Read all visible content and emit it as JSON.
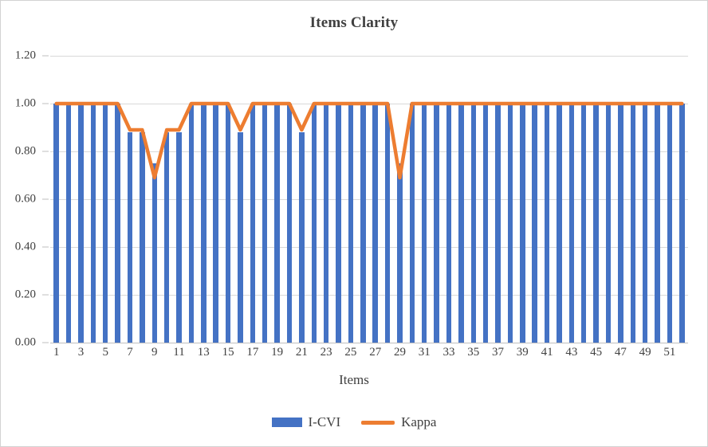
{
  "chart_data": {
    "type": "bar",
    "title": "Items Clarity",
    "xlabel": "Items",
    "ylabel": "",
    "ylim": [
      0.0,
      1.2
    ],
    "ytick_values": [
      0.0,
      0.2,
      0.4,
      0.6,
      0.8,
      1.0,
      1.2
    ],
    "ytick_labels": [
      "0.00",
      "0.20",
      "0.40",
      "0.60",
      "0.80",
      "1.00",
      "1.20"
    ],
    "grid": true,
    "legend_position": "bottom",
    "x": [
      1,
      2,
      3,
      4,
      5,
      6,
      7,
      8,
      9,
      10,
      11,
      12,
      13,
      14,
      15,
      16,
      17,
      18,
      19,
      20,
      21,
      22,
      23,
      24,
      25,
      26,
      27,
      28,
      29,
      30,
      31,
      32,
      33,
      34,
      35,
      36,
      37,
      38,
      39,
      40,
      41,
      42,
      43,
      44,
      45,
      46,
      47,
      48,
      49,
      50,
      51,
      52
    ],
    "xtick_labels": [
      "1",
      "3",
      "5",
      "7",
      "9",
      "11",
      "13",
      "15",
      "17",
      "19",
      "21",
      "23",
      "25",
      "27",
      "29",
      "31",
      "33",
      "35",
      "37",
      "39",
      "41",
      "43",
      "45",
      "47",
      "49",
      "51"
    ],
    "xtick_positions": [
      1,
      3,
      5,
      7,
      9,
      11,
      13,
      15,
      17,
      19,
      21,
      23,
      25,
      27,
      29,
      31,
      33,
      35,
      37,
      39,
      41,
      43,
      45,
      47,
      49,
      51
    ],
    "series": [
      {
        "name": "I-CVI",
        "type": "bar",
        "color": "#4472C4",
        "values": [
          1.0,
          1.0,
          1.0,
          1.0,
          1.0,
          1.0,
          0.88,
          0.88,
          0.75,
          0.88,
          0.88,
          1.0,
          1.0,
          1.0,
          1.0,
          0.88,
          1.0,
          1.0,
          1.0,
          1.0,
          0.88,
          1.0,
          1.0,
          1.0,
          1.0,
          1.0,
          1.0,
          1.0,
          0.75,
          1.0,
          1.0,
          1.0,
          1.0,
          1.0,
          1.0,
          1.0,
          1.0,
          1.0,
          1.0,
          1.0,
          1.0,
          1.0,
          1.0,
          1.0,
          1.0,
          1.0,
          1.0,
          1.0,
          1.0,
          1.0,
          1.0,
          1.0
        ]
      },
      {
        "name": "Kappa",
        "type": "line",
        "color": "#ED7D31",
        "values": [
          1.0,
          1.0,
          1.0,
          1.0,
          1.0,
          1.0,
          0.89,
          0.89,
          0.69,
          0.89,
          0.89,
          1.0,
          1.0,
          1.0,
          1.0,
          0.89,
          1.0,
          1.0,
          1.0,
          1.0,
          0.89,
          1.0,
          1.0,
          1.0,
          1.0,
          1.0,
          1.0,
          1.0,
          0.69,
          1.0,
          1.0,
          1.0,
          1.0,
          1.0,
          1.0,
          1.0,
          1.0,
          1.0,
          1.0,
          1.0,
          1.0,
          1.0,
          1.0,
          1.0,
          1.0,
          1.0,
          1.0,
          1.0,
          1.0,
          1.0,
          1.0,
          1.0
        ]
      }
    ]
  },
  "chart": {
    "title": "Items Clarity",
    "x_axis_title": "Items"
  },
  "legend": {
    "items": [
      {
        "label": "I-CVI",
        "marker": "bar-swatch",
        "color": "#4472C4"
      },
      {
        "label": "Kappa",
        "marker": "line-swatch",
        "color": "#ED7D31"
      }
    ]
  }
}
